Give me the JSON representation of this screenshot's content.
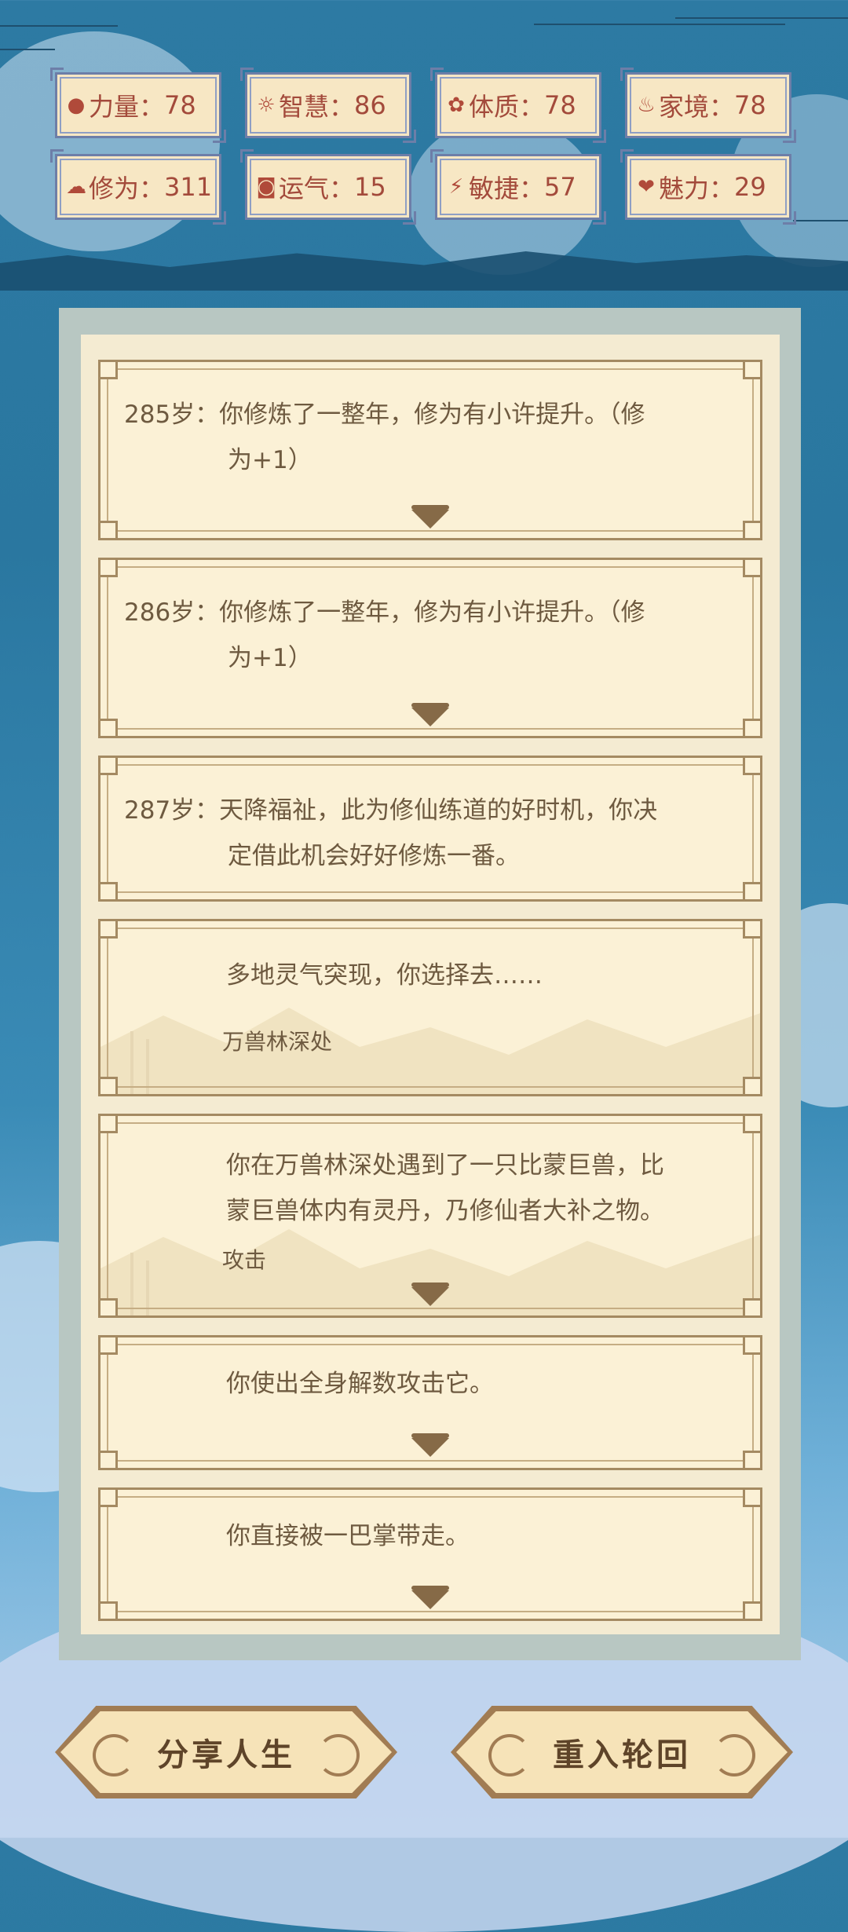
{
  "stats": [
    {
      "icon": "strength-icon",
      "glyph": "💪",
      "label": "力量",
      "value": "78"
    },
    {
      "icon": "wisdom-icon",
      "glyph": "☀",
      "label": "智慧",
      "value": "86"
    },
    {
      "icon": "constitution-icon",
      "glyph": "✿",
      "label": "体质",
      "value": "78"
    },
    {
      "icon": "family-icon",
      "glyph": "♨",
      "label": "家境",
      "value": "78"
    },
    {
      "icon": "cultivation-icon",
      "glyph": "☁",
      "label": "修为",
      "value": "311"
    },
    {
      "icon": "luck-icon",
      "glyph": "◙",
      "label": "运气",
      "value": "15"
    },
    {
      "icon": "agility-icon",
      "glyph": "⚡",
      "label": "敏捷",
      "value": "57"
    },
    {
      "icon": "charm-icon",
      "glyph": "❤",
      "label": "魅力",
      "value": "29"
    }
  ],
  "events": [
    {
      "age": "285岁：",
      "text": "你修炼了一整年，修为有小许提升。（修",
      "text2": "为+1）"
    },
    {
      "age": "286岁：",
      "text": "你修炼了一整年，修为有小许提升。（修",
      "text2": "为+1）"
    },
    {
      "age": "287岁：",
      "text": "天降福祉，此为修仙练道的好时机，你决",
      "text2": "定借此机会好好修炼一番。"
    },
    {
      "text": "多地灵气突现，你选择去……",
      "choice": "万兽林深处"
    },
    {
      "text": "你在万兽林深处遇到了一只比蒙巨兽，比",
      "text2": "蒙巨兽体内有灵丹，乃修仙者大补之物。",
      "choice": "攻击"
    },
    {
      "text": "你使出全身解数攻击它。"
    },
    {
      "text": "你直接被一巴掌带走。"
    }
  ],
  "buttons": {
    "share": "分享人生",
    "restart": "重入轮回"
  },
  "colors": {
    "background": "#2d7aa3",
    "card": "#fbf1d6",
    "text": "#6e5a40",
    "stat_text": "#a34a3b"
  }
}
